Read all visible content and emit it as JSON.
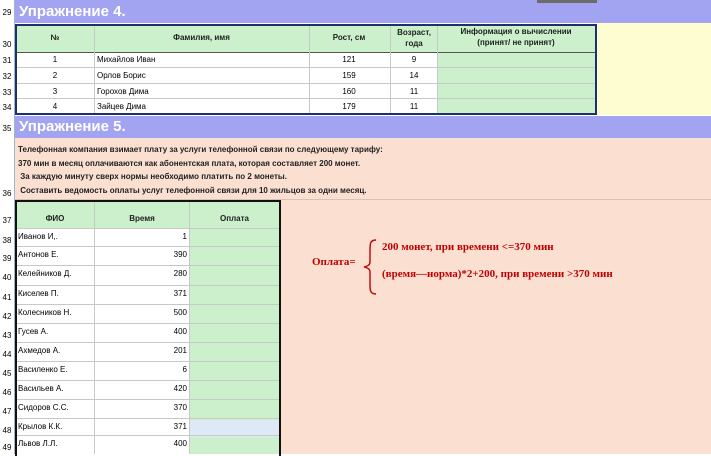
{
  "row_numbers": [
    "29",
    "30",
    "31",
    "32",
    "33",
    "34",
    "35",
    "36",
    "37",
    "38",
    "39",
    "40",
    "41",
    "42",
    "43",
    "44",
    "45",
    "46",
    "47",
    "48",
    "49"
  ],
  "ex4": {
    "title": "Упражнение 4.",
    "headers": {
      "num": "№",
      "name": "Фамилия, имя",
      "height": "Рост, см",
      "age": "Возраст, года",
      "info_line1": "Информация о вычислении",
      "info_line2": "(принят/ не принят)"
    },
    "rows": [
      {
        "num": "1",
        "name": "Михайлов Иван",
        "height": "121",
        "age": "9"
      },
      {
        "num": "2",
        "name": "Орлов Борис",
        "height": "159",
        "age": "14"
      },
      {
        "num": "3",
        "name": "Горохов Дима",
        "height": "160",
        "age": "11"
      },
      {
        "num": "4",
        "name": "Зайцев Дима",
        "height": "179",
        "age": "11"
      }
    ]
  },
  "ex5": {
    "title": "Упражнение 5.",
    "description": [
      "Телефонная компания взимает плату за услуги телефонной связи по следующему тарифу:",
      "370 мин в месяц оплачиваются как абонентская плата, которая составляет 200 монет.",
      " За каждую минуту сверх нормы необходимо платить по 2 монеты.",
      " Составить ведомость оплаты услуг телефонной связи для 10 жильцов за одни месяц."
    ],
    "headers": {
      "fio": "ФИО",
      "time": "Время",
      "pay": "Оплата"
    },
    "rows": [
      {
        "fio": "Иванов И,.",
        "time": "1"
      },
      {
        "fio": "Антонов Е.",
        "time": "390"
      },
      {
        "fio": "Келейников Д.",
        "time": "280"
      },
      {
        "fio": "Киселев П.",
        "time": "371"
      },
      {
        "fio": "Колесников Н.",
        "time": "500"
      },
      {
        "fio": "Гусев А.",
        "time": "400"
      },
      {
        "fio": "Ахмедов А.",
        "time": "201"
      },
      {
        "fio": "Василенко Е.",
        "time": "6"
      },
      {
        "fio": "Васильев А.",
        "time": "420"
      },
      {
        "fio": "Сидоров С.С.",
        "time": "370"
      },
      {
        "fio": "Крылов К.К.",
        "time": "371"
      },
      {
        "fio": "Львов Л.Л.",
        "time": "400"
      }
    ],
    "formula": {
      "label": "Оплата=",
      "case1": "200 монет, при времени <=370 мин",
      "case2": "(время—норма)*2+200, при времени >370 мин"
    }
  },
  "colors": {
    "band": "#a3a4f1",
    "band_text": "#ffffff",
    "green": "#ccf0cc",
    "pink": "#fbdfd1",
    "yellow": "#fefdd2",
    "formula_red": "#c00000",
    "header_text": "#1f1f1f"
  }
}
